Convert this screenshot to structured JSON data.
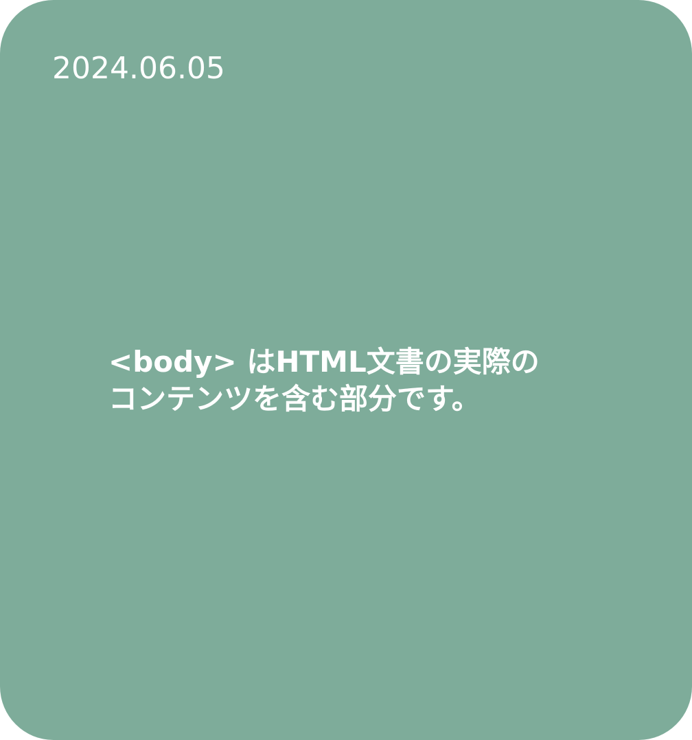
{
  "card": {
    "date": "2024.06.05",
    "message_lines": [
      "<body> はHTML文書の実際の",
      "コンテンツを含む部分です。"
    ]
  },
  "colors": {
    "background": "#7eac9a",
    "text": "#ffffff"
  }
}
